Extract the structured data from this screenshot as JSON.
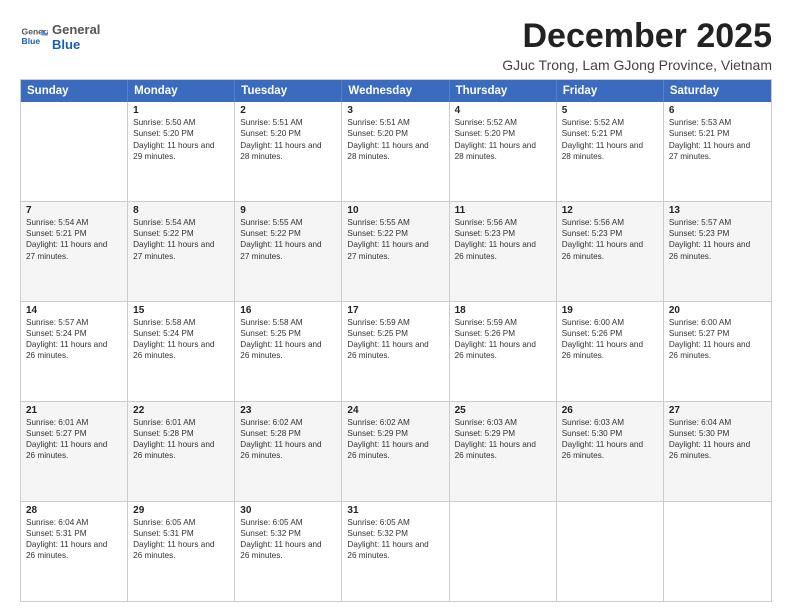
{
  "header": {
    "logo_line1": "General",
    "logo_line2": "Blue",
    "month_title": "December 2025",
    "location": "GJuc Trong, Lam GJong Province, Vietnam"
  },
  "days_of_week": [
    "Sunday",
    "Monday",
    "Tuesday",
    "Wednesday",
    "Thursday",
    "Friday",
    "Saturday"
  ],
  "rows": [
    [
      {
        "day": "",
        "sunrise": "",
        "sunset": "",
        "daylight": ""
      },
      {
        "day": "1",
        "sunrise": "Sunrise: 5:50 AM",
        "sunset": "Sunset: 5:20 PM",
        "daylight": "Daylight: 11 hours and 29 minutes."
      },
      {
        "day": "2",
        "sunrise": "Sunrise: 5:51 AM",
        "sunset": "Sunset: 5:20 PM",
        "daylight": "Daylight: 11 hours and 28 minutes."
      },
      {
        "day": "3",
        "sunrise": "Sunrise: 5:51 AM",
        "sunset": "Sunset: 5:20 PM",
        "daylight": "Daylight: 11 hours and 28 minutes."
      },
      {
        "day": "4",
        "sunrise": "Sunrise: 5:52 AM",
        "sunset": "Sunset: 5:20 PM",
        "daylight": "Daylight: 11 hours and 28 minutes."
      },
      {
        "day": "5",
        "sunrise": "Sunrise: 5:52 AM",
        "sunset": "Sunset: 5:21 PM",
        "daylight": "Daylight: 11 hours and 28 minutes."
      },
      {
        "day": "6",
        "sunrise": "Sunrise: 5:53 AM",
        "sunset": "Sunset: 5:21 PM",
        "daylight": "Daylight: 11 hours and 27 minutes."
      }
    ],
    [
      {
        "day": "7",
        "sunrise": "Sunrise: 5:54 AM",
        "sunset": "Sunset: 5:21 PM",
        "daylight": "Daylight: 11 hours and 27 minutes."
      },
      {
        "day": "8",
        "sunrise": "Sunrise: 5:54 AM",
        "sunset": "Sunset: 5:22 PM",
        "daylight": "Daylight: 11 hours and 27 minutes."
      },
      {
        "day": "9",
        "sunrise": "Sunrise: 5:55 AM",
        "sunset": "Sunset: 5:22 PM",
        "daylight": "Daylight: 11 hours and 27 minutes."
      },
      {
        "day": "10",
        "sunrise": "Sunrise: 5:55 AM",
        "sunset": "Sunset: 5:22 PM",
        "daylight": "Daylight: 11 hours and 27 minutes."
      },
      {
        "day": "11",
        "sunrise": "Sunrise: 5:56 AM",
        "sunset": "Sunset: 5:23 PM",
        "daylight": "Daylight: 11 hours and 26 minutes."
      },
      {
        "day": "12",
        "sunrise": "Sunrise: 5:56 AM",
        "sunset": "Sunset: 5:23 PM",
        "daylight": "Daylight: 11 hours and 26 minutes."
      },
      {
        "day": "13",
        "sunrise": "Sunrise: 5:57 AM",
        "sunset": "Sunset: 5:23 PM",
        "daylight": "Daylight: 11 hours and 26 minutes."
      }
    ],
    [
      {
        "day": "14",
        "sunrise": "Sunrise: 5:57 AM",
        "sunset": "Sunset: 5:24 PM",
        "daylight": "Daylight: 11 hours and 26 minutes."
      },
      {
        "day": "15",
        "sunrise": "Sunrise: 5:58 AM",
        "sunset": "Sunset: 5:24 PM",
        "daylight": "Daylight: 11 hours and 26 minutes."
      },
      {
        "day": "16",
        "sunrise": "Sunrise: 5:58 AM",
        "sunset": "Sunset: 5:25 PM",
        "daylight": "Daylight: 11 hours and 26 minutes."
      },
      {
        "day": "17",
        "sunrise": "Sunrise: 5:59 AM",
        "sunset": "Sunset: 5:25 PM",
        "daylight": "Daylight: 11 hours and 26 minutes."
      },
      {
        "day": "18",
        "sunrise": "Sunrise: 5:59 AM",
        "sunset": "Sunset: 5:26 PM",
        "daylight": "Daylight: 11 hours and 26 minutes."
      },
      {
        "day": "19",
        "sunrise": "Sunrise: 6:00 AM",
        "sunset": "Sunset: 5:26 PM",
        "daylight": "Daylight: 11 hours and 26 minutes."
      },
      {
        "day": "20",
        "sunrise": "Sunrise: 6:00 AM",
        "sunset": "Sunset: 5:27 PM",
        "daylight": "Daylight: 11 hours and 26 minutes."
      }
    ],
    [
      {
        "day": "21",
        "sunrise": "Sunrise: 6:01 AM",
        "sunset": "Sunset: 5:27 PM",
        "daylight": "Daylight: 11 hours and 26 minutes."
      },
      {
        "day": "22",
        "sunrise": "Sunrise: 6:01 AM",
        "sunset": "Sunset: 5:28 PM",
        "daylight": "Daylight: 11 hours and 26 minutes."
      },
      {
        "day": "23",
        "sunrise": "Sunrise: 6:02 AM",
        "sunset": "Sunset: 5:28 PM",
        "daylight": "Daylight: 11 hours and 26 minutes."
      },
      {
        "day": "24",
        "sunrise": "Sunrise: 6:02 AM",
        "sunset": "Sunset: 5:29 PM",
        "daylight": "Daylight: 11 hours and 26 minutes."
      },
      {
        "day": "25",
        "sunrise": "Sunrise: 6:03 AM",
        "sunset": "Sunset: 5:29 PM",
        "daylight": "Daylight: 11 hours and 26 minutes."
      },
      {
        "day": "26",
        "sunrise": "Sunrise: 6:03 AM",
        "sunset": "Sunset: 5:30 PM",
        "daylight": "Daylight: 11 hours and 26 minutes."
      },
      {
        "day": "27",
        "sunrise": "Sunrise: 6:04 AM",
        "sunset": "Sunset: 5:30 PM",
        "daylight": "Daylight: 11 hours and 26 minutes."
      }
    ],
    [
      {
        "day": "28",
        "sunrise": "Sunrise: 6:04 AM",
        "sunset": "Sunset: 5:31 PM",
        "daylight": "Daylight: 11 hours and 26 minutes."
      },
      {
        "day": "29",
        "sunrise": "Sunrise: 6:05 AM",
        "sunset": "Sunset: 5:31 PM",
        "daylight": "Daylight: 11 hours and 26 minutes."
      },
      {
        "day": "30",
        "sunrise": "Sunrise: 6:05 AM",
        "sunset": "Sunset: 5:32 PM",
        "daylight": "Daylight: 11 hours and 26 minutes."
      },
      {
        "day": "31",
        "sunrise": "Sunrise: 6:05 AM",
        "sunset": "Sunset: 5:32 PM",
        "daylight": "Daylight: 11 hours and 26 minutes."
      },
      {
        "day": "",
        "sunrise": "",
        "sunset": "",
        "daylight": ""
      },
      {
        "day": "",
        "sunrise": "",
        "sunset": "",
        "daylight": ""
      },
      {
        "day": "",
        "sunrise": "",
        "sunset": "",
        "daylight": ""
      }
    ]
  ]
}
